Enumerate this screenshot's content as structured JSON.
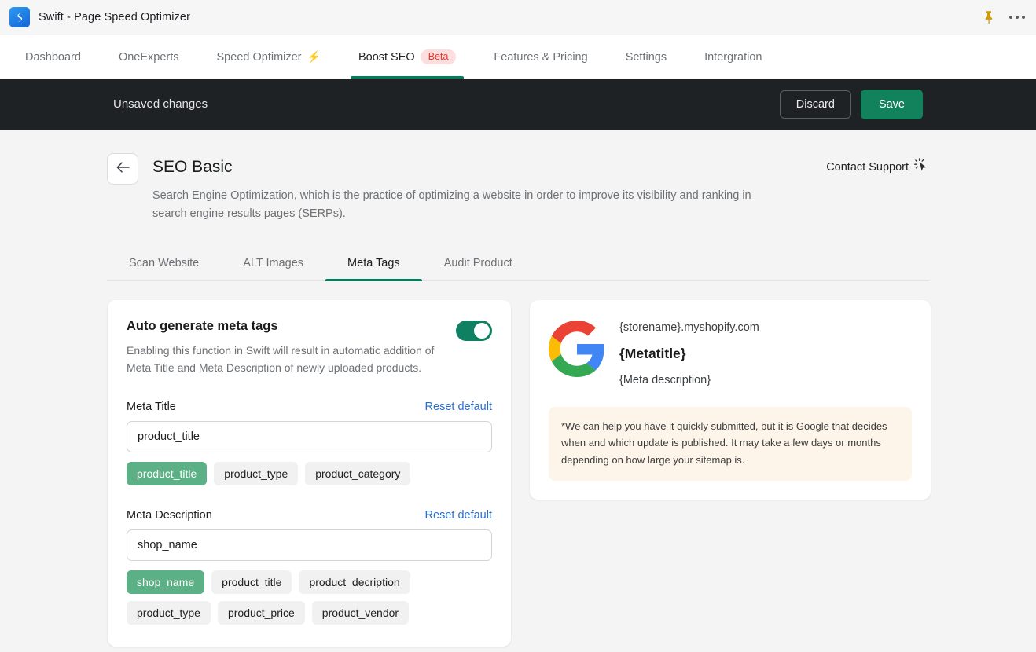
{
  "titlebar": {
    "app_name": "Swift - Page Speed Optimizer",
    "pin_icon": "pushpin-icon",
    "more_icon": "more-horizontal-icon"
  },
  "nav": {
    "tabs": [
      {
        "label": "Dashboard",
        "active": false
      },
      {
        "label": "OneExperts",
        "active": false
      },
      {
        "label": "Speed Optimizer",
        "active": false,
        "icon": "bolt-icon",
        "icon_glyph": "⚡"
      },
      {
        "label": "Boost SEO",
        "active": true,
        "badge": "Beta"
      },
      {
        "label": "Features & Pricing",
        "active": false
      },
      {
        "label": "Settings",
        "active": false
      },
      {
        "label": "Intergration",
        "active": false
      }
    ]
  },
  "savebar": {
    "message": "Unsaved changes",
    "discard_label": "Discard",
    "save_label": "Save",
    "background": "#1f2225",
    "save_color": "#12825c"
  },
  "page": {
    "back_icon": "arrow-left-icon",
    "title": "SEO Basic",
    "description": "Search Engine Optimization, which is the practice of optimizing a website in order to improve its visibility and ranking in search engine results pages (SERPs).",
    "contact_support_label": "Contact Support",
    "contact_support_icon": "cursor-click-icon"
  },
  "subtabs": [
    {
      "label": "Scan Website",
      "active": false
    },
    {
      "label": "ALT Images",
      "active": false
    },
    {
      "label": "Meta Tags",
      "active": true
    },
    {
      "label": "Audit Product",
      "active": false
    }
  ],
  "settings_card": {
    "title": "Auto generate meta tags",
    "description": "Enabling this function in Swift will result in automatic addition of Meta Title and Meta Description of newly uploaded products.",
    "toggle_on": true,
    "toggle_color": "#0f8061",
    "meta_title": {
      "label": "Meta Title",
      "reset_label": "Reset default",
      "value": "product_title",
      "placeholder": "product_title",
      "chips": [
        {
          "label": "product_title",
          "selected": true
        },
        {
          "label": "product_type",
          "selected": false
        },
        {
          "label": "product_category",
          "selected": false
        }
      ]
    },
    "meta_description": {
      "label": "Meta Description",
      "reset_label": "Reset default",
      "value": "shop_name",
      "placeholder": "shop_name",
      "chips": [
        {
          "label": "shop_name",
          "selected": true
        },
        {
          "label": "product_title",
          "selected": false
        },
        {
          "label": "product_decription",
          "selected": false
        },
        {
          "label": "product_type",
          "selected": false
        },
        {
          "label": "product_price",
          "selected": false
        },
        {
          "label": "product_vendor",
          "selected": false
        }
      ]
    },
    "chip_selected_color": "#5cb085"
  },
  "preview_card": {
    "logo_icon": "google-logo-icon",
    "url": "{storename}.myshopify.com",
    "title": "{Metatitle}",
    "description": "{Meta description}",
    "note": "*We can help you have it quickly submitted, but it is Google that decides when and which update is published. It may take a few days or months depending on how large your sitemap is.",
    "note_background": "#fdf5ea"
  }
}
